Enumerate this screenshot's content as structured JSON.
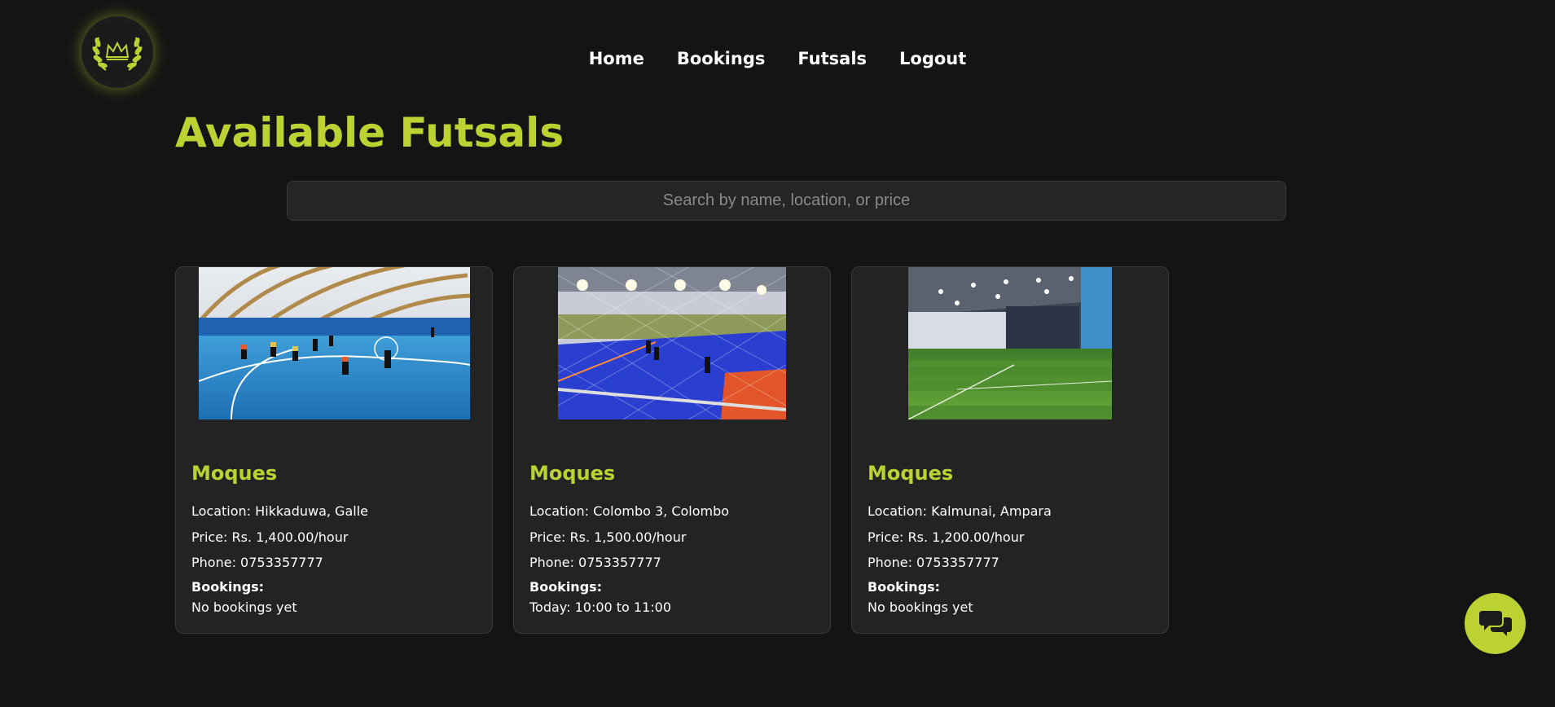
{
  "nav": {
    "items": [
      {
        "label": "Home"
      },
      {
        "label": "Bookings"
      },
      {
        "label": "Futsals"
      },
      {
        "label": "Logout"
      }
    ]
  },
  "page": {
    "title": "Available Futsals"
  },
  "search": {
    "placeholder": "Search by name, location, or price",
    "value": ""
  },
  "cards": [
    {
      "name": "Moques",
      "location_label": "Location:",
      "location": "Hikkaduwa, Galle",
      "price_label": "Price:",
      "price": "Rs. 1,400.00/hour",
      "phone_label": "Phone:",
      "phone": "0753357777",
      "bookings_label": "Bookings:",
      "bookings": "No bookings yet",
      "image": "indoor-futsal-court-blue-photo"
    },
    {
      "name": "Moques",
      "location_label": "Location:",
      "location": "Colombo 3, Colombo",
      "price_label": "Price:",
      "price": "Rs. 1,500.00/hour",
      "phone_label": "Phone:",
      "phone": "0753357777",
      "bookings_label": "Bookings:",
      "bookings": "Today: 10:00 to 11:00",
      "image": "netted-futsal-court-photo"
    },
    {
      "name": "Moques",
      "location_label": "Location:",
      "location": "Kalmunai, Ampara",
      "price_label": "Price:",
      "price": "Rs. 1,200.00/hour",
      "phone_label": "Phone:",
      "phone": "0753357777",
      "bookings_label": "Bookings:",
      "bookings": "No bookings yet",
      "image": "indoor-turf-field-photo"
    }
  ],
  "icons": {
    "logo": "laurel-crown-icon",
    "chat": "chat-bubbles-icon"
  },
  "colors": {
    "accent": "#bcd233",
    "background": "#141414",
    "card": "#232323"
  }
}
